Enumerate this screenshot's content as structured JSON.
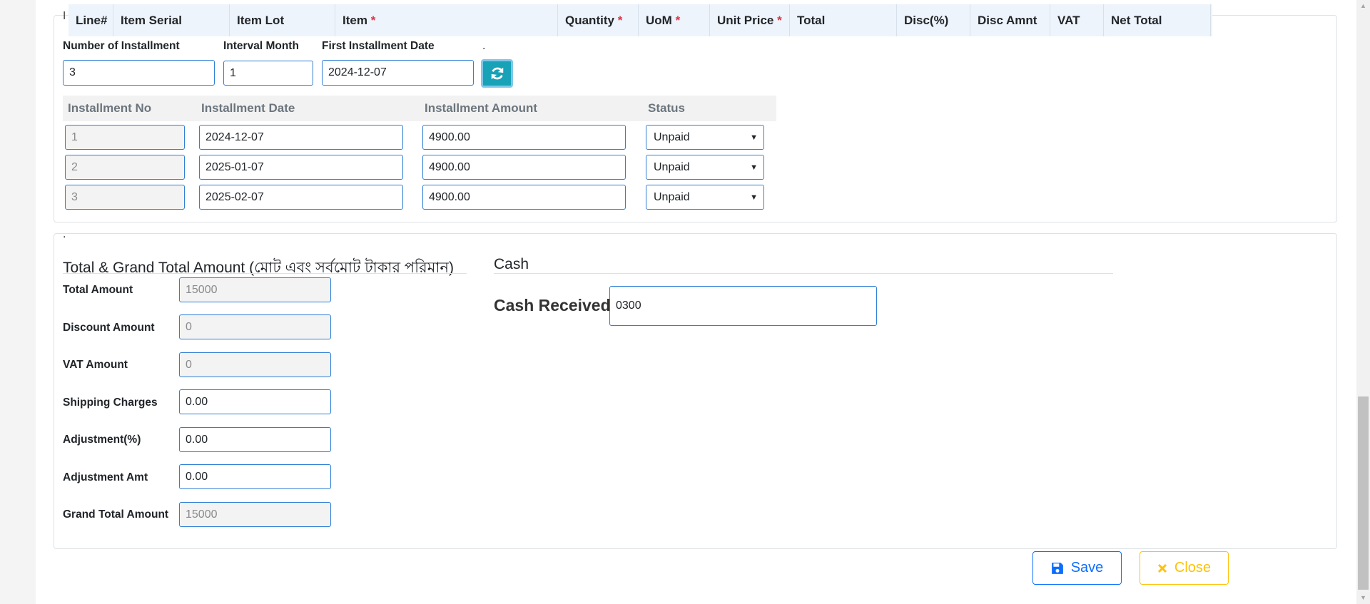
{
  "items_table": {
    "columns": [
      {
        "label": "Line#",
        "required": false
      },
      {
        "label": "Item Serial",
        "required": false
      },
      {
        "label": "Item Lot",
        "required": false
      },
      {
        "label": "Item",
        "required": true
      },
      {
        "label": "Quantity",
        "required": true
      },
      {
        "label": "UoM",
        "required": true
      },
      {
        "label": "Unit Price",
        "required": true
      },
      {
        "label": "Total",
        "required": false
      },
      {
        "label": "Disc(%)",
        "required": false
      },
      {
        "label": "Disc Amnt",
        "required": false
      },
      {
        "label": "VAT",
        "required": false
      },
      {
        "label": "Net Total",
        "required": false
      }
    ],
    "required_marker": "*",
    "hidden_partial_label": "I"
  },
  "installment": {
    "number_label": "Number of Installment",
    "number_value": "3",
    "interval_label": "Interval Month",
    "interval_value": "1",
    "first_date_label": "First Installment Date",
    "first_date_value": "2024-12-07",
    "refresh_label": ".",
    "headers": {
      "no": "Installment No",
      "date": "Installment Date",
      "amount": "Installment Amount",
      "status": "Status"
    },
    "rows": [
      {
        "no": "1",
        "date": "2024-12-07",
        "amount": "4900.00",
        "status": "Unpaid"
      },
      {
        "no": "2",
        "date": "2025-01-07",
        "amount": "4900.00",
        "status": "Unpaid"
      },
      {
        "no": "3",
        "date": "2025-02-07",
        "amount": "4900.00",
        "status": "Unpaid"
      }
    ]
  },
  "totals": {
    "dot": ".",
    "title": "Total & Grand Total Amount (মোট এবং সর্বমোট টাকার পরিমান)",
    "total_amount_label": "Total Amount",
    "total_amount_value": "15000",
    "discount_label": "Discount Amount",
    "discount_value": "0",
    "vat_label": "VAT Amount",
    "vat_value": "0",
    "shipping_label": "Shipping Charges",
    "shipping_value": "0.00",
    "adj_pct_label": "Adjustment(%)",
    "adj_pct_value": "0.00",
    "adj_amt_label": "Adjustment Amt",
    "adj_amt_value": "0.00",
    "grand_total_label": "Grand Total Amount",
    "grand_total_value": "15000"
  },
  "cash": {
    "title": "Cash",
    "received_label": "Cash Received",
    "received_value": "0300"
  },
  "actions": {
    "save_label": "Save",
    "close_label": "Close"
  },
  "colors": {
    "accent": "#0d6efd",
    "info": "#17a2b8",
    "warning": "#ffc107",
    "required": "#dc3545"
  },
  "icons": {
    "save": "floppy-disk-icon",
    "close": "x-icon",
    "refresh": "refresh-icon"
  }
}
